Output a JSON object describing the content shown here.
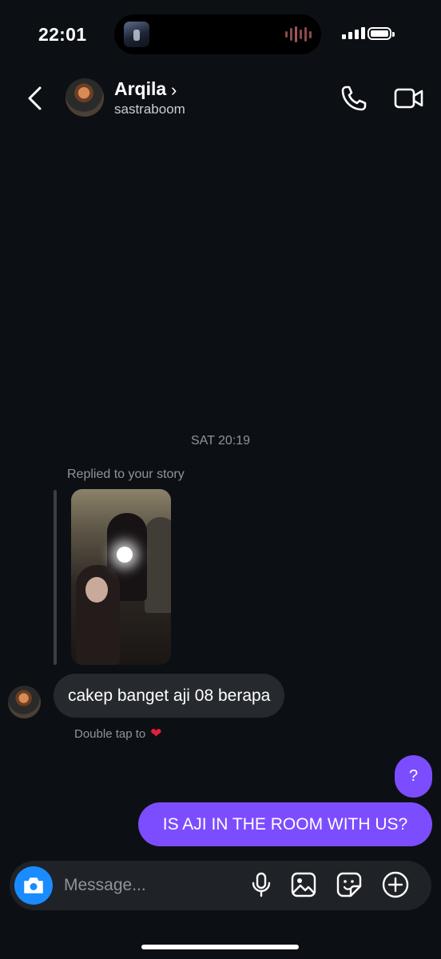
{
  "status_bar": {
    "time": "22:01"
  },
  "header": {
    "contact_name": "Arqila",
    "username": "sastraboom",
    "chevron": "›"
  },
  "thread": {
    "timestamp": "SAT 20:19",
    "replied_label": "Replied to your story",
    "incoming": [
      {
        "text": "cakep banget aji 08 berapa"
      }
    ],
    "double_tap_hint": "Double tap to",
    "double_tap_icon": "heart-icon",
    "outgoing": [
      {
        "text": "?"
      },
      {
        "text": "IS AJI IN THE ROOM WITH US?"
      }
    ]
  },
  "composer": {
    "placeholder": "Message...",
    "icons": [
      "camera-icon",
      "microphone-icon",
      "gallery-icon",
      "sticker-icon",
      "plus-circle-icon"
    ]
  },
  "colors": {
    "background": "#0c1014",
    "outgoing_bubble": "#7c4dff",
    "incoming_bubble": "#262a2f",
    "camera_button": "#1a8cff",
    "heart": "#e0203a"
  }
}
